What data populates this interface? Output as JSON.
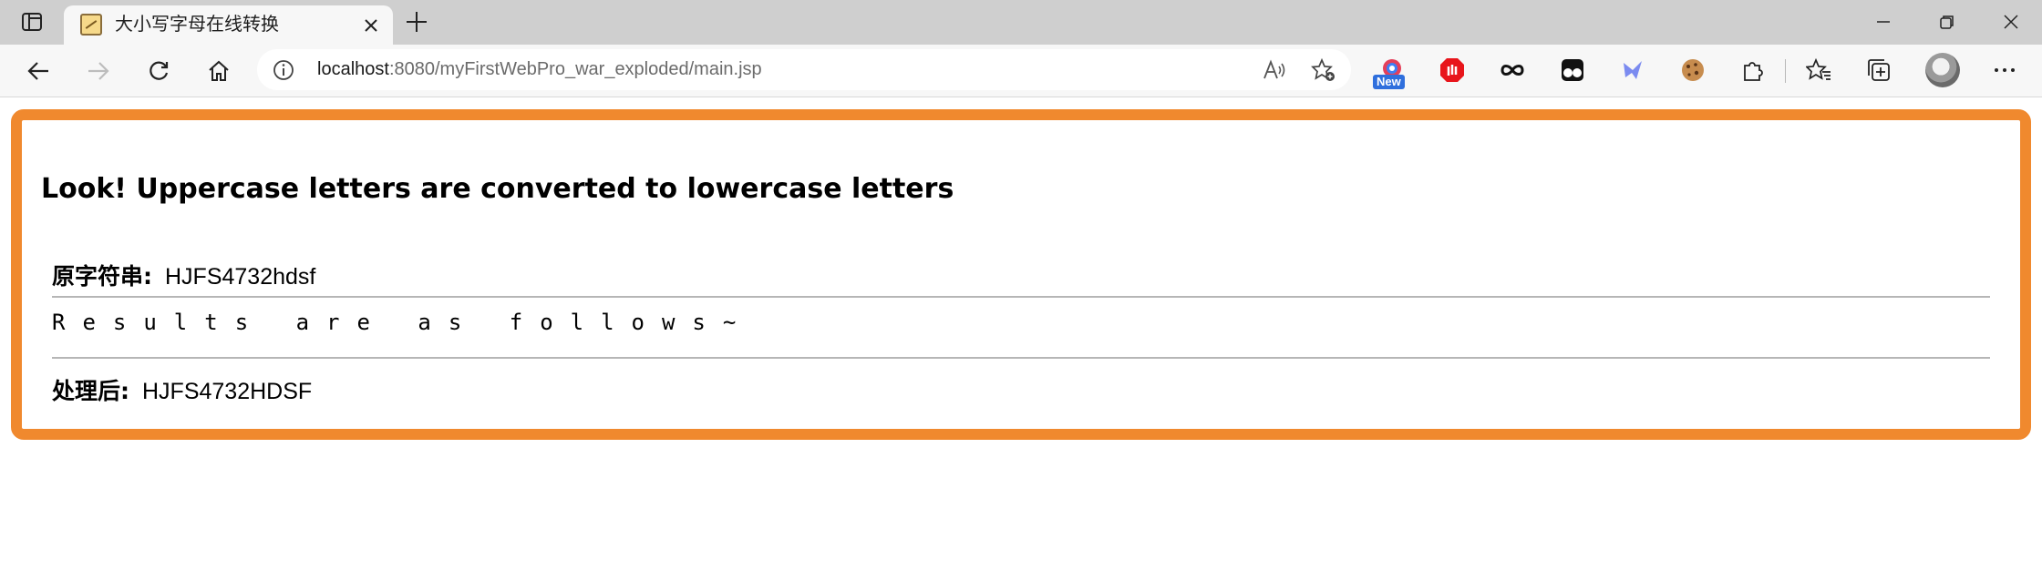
{
  "browser": {
    "tab": {
      "title": "大小写字母在线转换"
    },
    "address": {
      "host": "localhost",
      "rest": ":8080/myFirstWebPro_war_exploded/main.jsp"
    },
    "extensions": {
      "new_badge": "New"
    }
  },
  "page": {
    "heading": "Look! Uppercase letters are converted to lowercase letters",
    "original": {
      "label": "原字符串:",
      "value": "HJFS4732hdsf"
    },
    "results_text": "Results are as follows~",
    "processed": {
      "label": "处理后:",
      "value": "HJFS4732HDSF"
    }
  },
  "colors": {
    "frame_border": "#f0892e",
    "titlebar": "#cfcfcf",
    "toolbar": "#f7f7f7"
  }
}
